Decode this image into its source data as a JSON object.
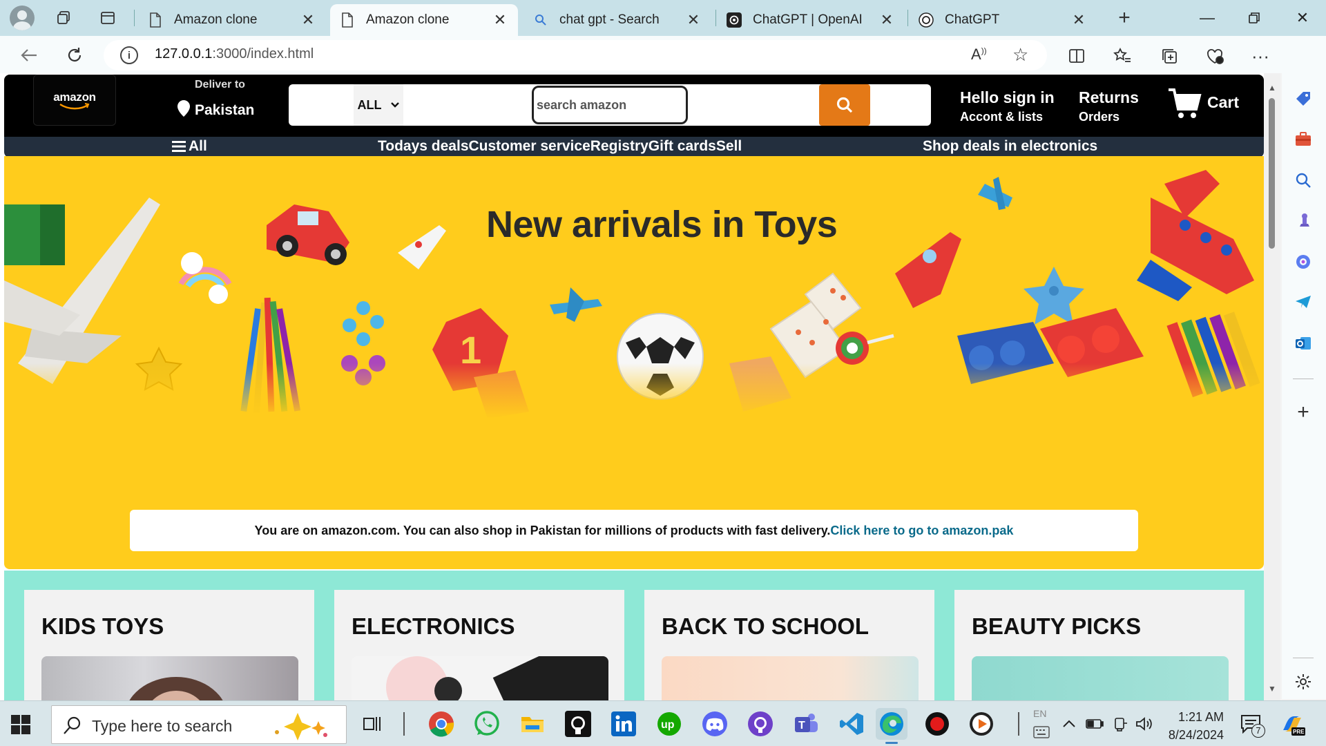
{
  "browser": {
    "tabs": [
      {
        "title": "Amazon clone",
        "active": false
      },
      {
        "title": "Amazon clone",
        "active": true
      },
      {
        "title": "chat gpt - Search",
        "active": false
      },
      {
        "title": "ChatGPT | OpenAI",
        "active": false
      },
      {
        "title": "ChatGPT",
        "active": false
      }
    ],
    "url_host": "127.0.0.1",
    "url_rest": ":3000/index.html"
  },
  "header": {
    "logo": "amazon",
    "deliver_label": "Deliver to",
    "deliver_country": "Pakistan",
    "search_category": "ALL",
    "search_placeholder": "search amazon",
    "account_line1": "Hello sign in",
    "account_line2": "Accont & lists",
    "returns_line1": "Returns",
    "returns_line2": "Orders",
    "cart_label": "Cart"
  },
  "subnav": {
    "all_label": "All",
    "links": [
      "Todays deals",
      "Customer service",
      "Registry",
      "Gift cards",
      "Sell"
    ],
    "deals_label": "Shop deals in electronics"
  },
  "hero": {
    "title": "New arrivals in Toys",
    "notice_text": "You are on amazon.com. You can also shop in Pakistan for millions of products with fast delivery.",
    "notice_link": "Click here to go to amazon.pak"
  },
  "cards": [
    {
      "title": "KIDS TOYS"
    },
    {
      "title": "ELECTRONICS"
    },
    {
      "title": "BACK TO SCHOOL"
    },
    {
      "title": "BEAUTY PICKS"
    }
  ],
  "taskbar": {
    "search_placeholder": "Type here to search",
    "lang": "EN",
    "time": "1:21 AM",
    "date": "8/24/2024",
    "notification_count": "7"
  },
  "colors": {
    "amazon_orange": "#e47917",
    "hero_yellow": "#ffcc1c",
    "subnav_bg": "#232f3e",
    "cards_bg": "#8ee8d6",
    "link_teal": "#0a6a8a"
  }
}
